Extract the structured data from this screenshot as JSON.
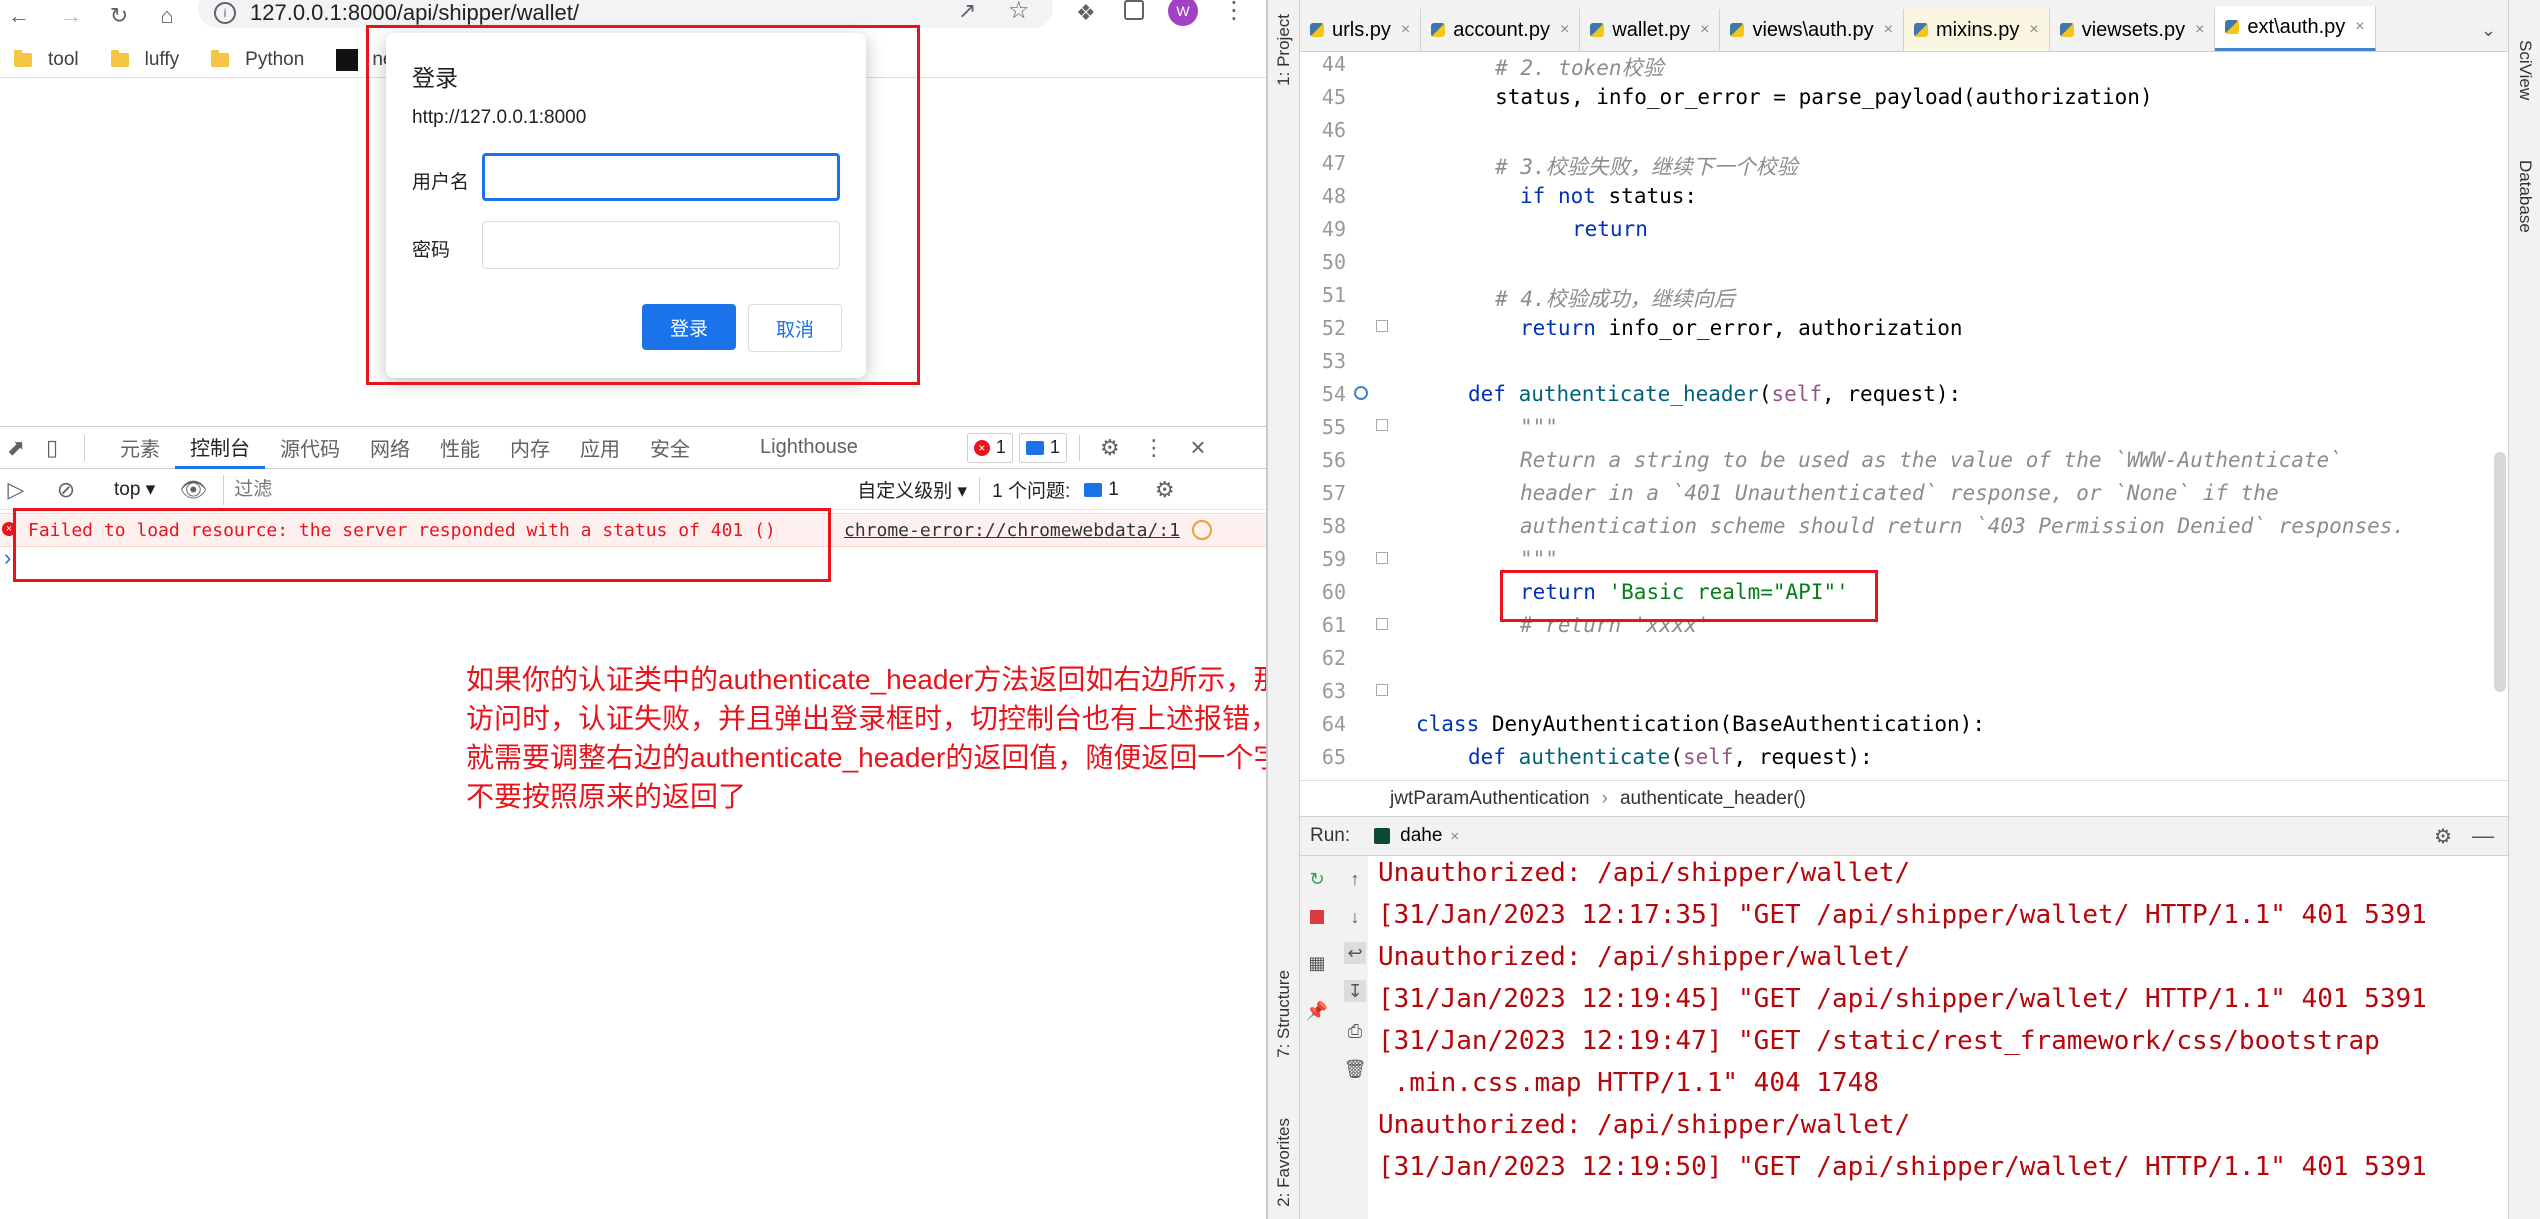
{
  "browser": {
    "url": "127.0.0.1:8000/api/shipper/wallet/",
    "avatar_letter": "W",
    "bookmarks": [
      "tool",
      "luffy",
      "Python",
      "nee"
    ],
    "login_dialog": {
      "title": "登录",
      "origin": "http://127.0.0.1:8000",
      "username_label": "用户名",
      "username_value": "",
      "password_label": "密码",
      "password_value": "",
      "login_button": "登录",
      "cancel_button": "取消"
    },
    "devtools": {
      "tabs": [
        "元素",
        "控制台",
        "源代码",
        "网络",
        "性能",
        "内存",
        "应用",
        "安全",
        "Lighthouse"
      ],
      "active_tab": "控制台",
      "error_count": "1",
      "message_count": "1",
      "context": "top",
      "filter_placeholder": "过滤",
      "level": "自定义级别",
      "issues_label": "1 个问题:",
      "issues_count": "1",
      "error_message": "Failed to load resource: the server responded with a status of 401 ()",
      "error_source": "chrome-error://chromewebdata/:1",
      "prompt": "›"
    },
    "annotation": "如果你的认证类中的authenticate_header方法返回如右边所示，那么前端访问时，认证失败，并且弹出登录框时，切控制台也有上述报错，那么你就需要调整右边的authenticate_header的返回值，随便返回一个字符串，不要按照原来的返回了"
  },
  "ide": {
    "left_tool_windows": [
      "1: Project",
      "7: Structure",
      "2: Favorites"
    ],
    "right_tool_windows": [
      "SciView",
      "Database"
    ],
    "editor_tabs": [
      "urls.py",
      "account.py",
      "wallet.py",
      "views\\auth.py",
      "mixins.py",
      "viewsets.py",
      "ext\\auth.py"
    ],
    "active_tab": "ext\\auth.py",
    "line_numbers": [
      "44",
      "45",
      "46",
      "47",
      "48",
      "49",
      "50",
      "51",
      "52",
      "53",
      "54",
      "55",
      "56",
      "57",
      "58",
      "59",
      "60",
      "61",
      "62",
      "63",
      "64",
      "65"
    ],
    "code": {
      "l44": "        # 2. token校验",
      "l45": "        status, info_or_error = parse_payload(authorization)",
      "l47": "        # 3.校验失败，继续下一个校验",
      "l48_kw1": "if",
      "l48_kw2": "not",
      "l48_rest": " status:",
      "l49": "return",
      "l51": "        # 4.校验成功，继续向后",
      "l52_kw": "return",
      "l52_rest": " info_or_error, authorization",
      "l54_kw": "def",
      "l54_fn": "authenticate_header",
      "l54_self": "self",
      "l54_rest": ", request):",
      "l55": "\"\"\"",
      "l56": "Return a string to be used as the value of the `WWW-Authenticate`",
      "l57": "header in a `401 Unauthenticated` response, or `None` if the",
      "l58": "authentication scheme should return `403 Permission Denied` responses.",
      "l59": "\"\"\"",
      "l60_kw": "return",
      "l60_str": "'Basic realm=\"API\"'",
      "l61": "# return 'xxxx'",
      "l64_kw": "class",
      "l64_name": "DenyAuthentication",
      "l64_rest": "(BaseAuthentication):",
      "l65_kw": "def",
      "l65_fn": "authenticate",
      "l65_self": "self",
      "l65_rest": ", request):"
    },
    "breadcrumb": [
      "jwtParamAuthentication",
      "authenticate_header()"
    ],
    "run": {
      "label": "Run:",
      "config": "dahe",
      "output": [
        "Unauthorized: /api/shipper/wallet/",
        "[31/Jan/2023 12:17:35] \"GET /api/shipper/wallet/ HTTP/1.1\" 401 5391",
        "Unauthorized: /api/shipper/wallet/",
        "[31/Jan/2023 12:19:45] \"GET /api/shipper/wallet/ HTTP/1.1\" 401 5391",
        "[31/Jan/2023 12:19:47] \"GET /static/rest_framework/css/bootstrap",
        " .min.css.map HTTP/1.1\" 404 1748",
        "Unauthorized: /api/shipper/wallet/",
        "[31/Jan/2023 12:19:50] \"GET /api/shipper/wallet/ HTTP/1.1\" 401 5391"
      ]
    }
  },
  "colors": {
    "annotation_red": "#e8141c",
    "chrome_blue": "#1a73e8",
    "output_red": "#b5060c"
  }
}
